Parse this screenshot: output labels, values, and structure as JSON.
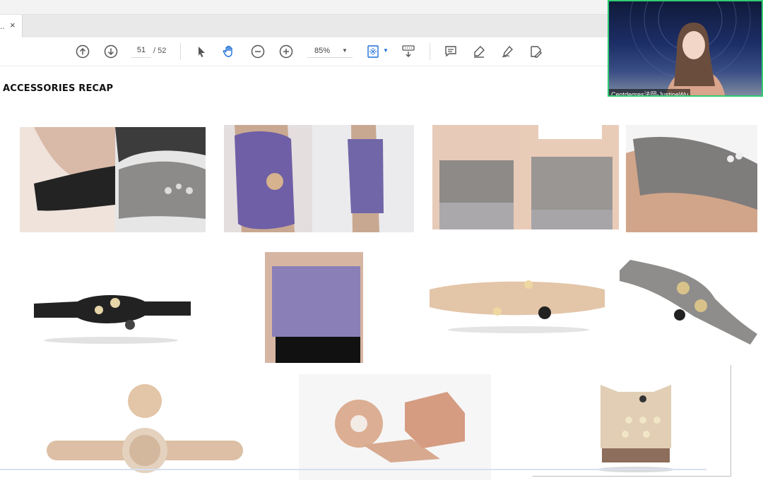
{
  "tab": {
    "dots": "..",
    "close": "×"
  },
  "toolbar": {
    "page_current": "51",
    "page_total": "/ 52",
    "zoom": "85%",
    "icons": [
      "scroll-up-icon",
      "scroll-down-icon",
      "select-arrow-icon",
      "hand-tool-icon",
      "zoom-out-icon",
      "zoom-in-icon",
      "fit-page-icon",
      "read-mode-icon",
      "comment-icon",
      "highlight-pen-icon",
      "sign-icon",
      "edit-pdf-icon"
    ]
  },
  "document": {
    "title": "ACCESSORIES RECAP"
  },
  "video": {
    "participant_name": "Centdegres法岡-JustineWu"
  },
  "colors": {
    "accent_blue": "#1d6fd8",
    "video_border": "#2ecc71",
    "beige": "#e3c5a8",
    "grey_brace": "#8e8a88",
    "purple_brace": "#7166a8",
    "black_band": "#222222"
  }
}
